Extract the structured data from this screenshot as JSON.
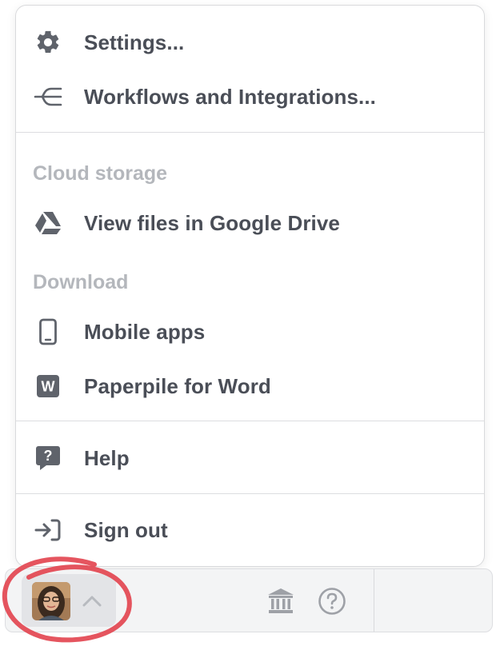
{
  "menu": {
    "settings_label": "Settings...",
    "workflows_label": "Workflows and Integrations...",
    "cloud_storage_heading": "Cloud storage",
    "google_drive_label": "View files in Google Drive",
    "download_heading": "Download",
    "mobile_apps_label": "Mobile apps",
    "word_label": "Paperpile for Word",
    "word_icon_letter": "W",
    "help_label": "Help",
    "sign_out_label": "Sign out"
  },
  "icons": {
    "settings": "gear-icon",
    "workflows": "workflow-branch-icon",
    "google_drive": "google-drive-icon",
    "mobile_apps": "smartphone-icon",
    "word": "word-icon",
    "help": "help-chat-icon",
    "sign_out": "sign-in-arrow-icon",
    "toolbar_chevron": "chevron-up-icon",
    "toolbar_library": "library-building-icon",
    "toolbar_help": "question-circle-icon"
  },
  "colors": {
    "menu_text": "#4a4e57",
    "section_heading": "#b4b7bc",
    "icon": "#5f636b",
    "highlight_ring": "#e2434e"
  }
}
